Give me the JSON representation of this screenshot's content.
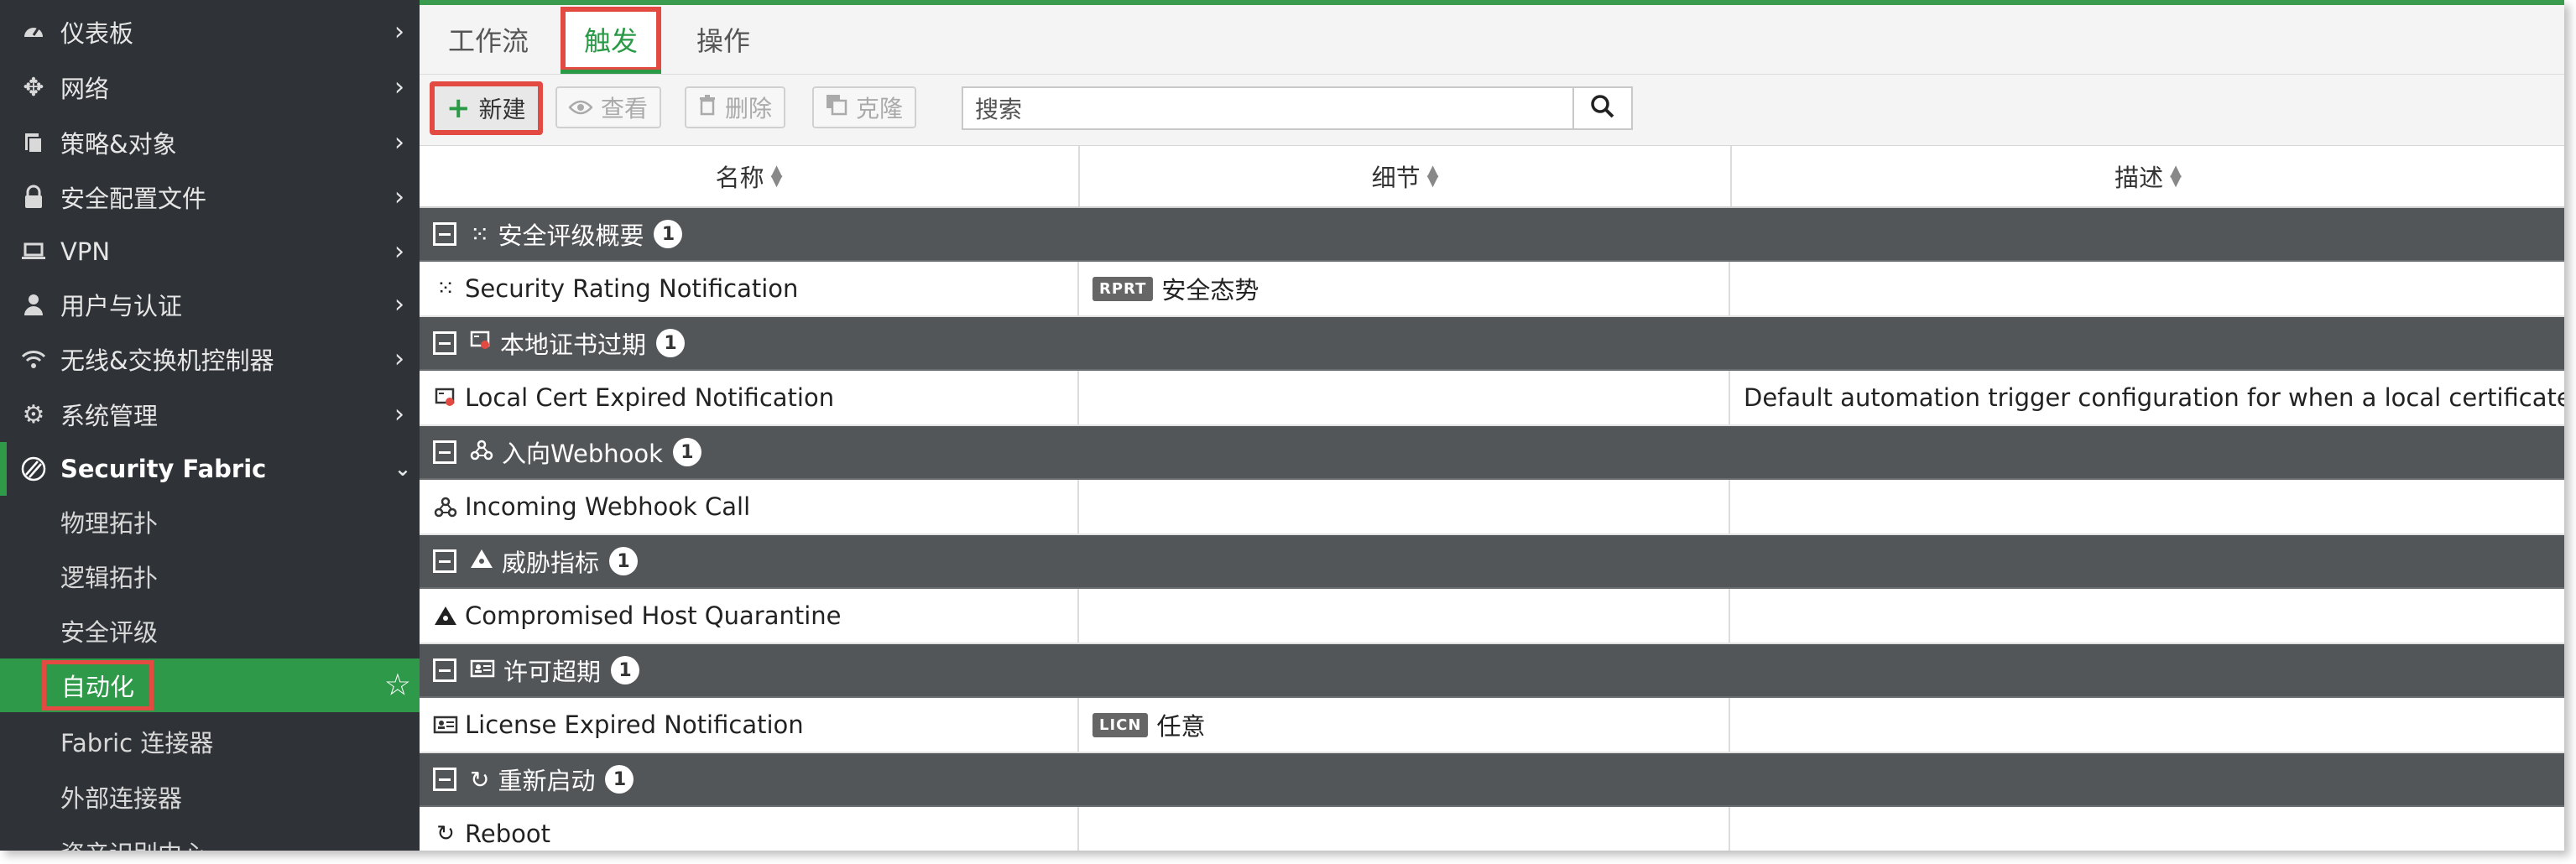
{
  "sidebar": {
    "items": [
      {
        "label": "仪表板",
        "icon": "dashboard-icon"
      },
      {
        "label": "网络",
        "icon": "network-icon"
      },
      {
        "label": "策略&对象",
        "icon": "policy-icon"
      },
      {
        "label": "安全配置文件",
        "icon": "lock-icon"
      },
      {
        "label": "VPN",
        "icon": "laptop-icon"
      },
      {
        "label": "用户与认证",
        "icon": "user-icon"
      },
      {
        "label": "无线&交换机控制器",
        "icon": "wifi-icon"
      },
      {
        "label": "系统管理",
        "icon": "gear-icon"
      }
    ],
    "section": {
      "label": "Security Fabric",
      "icon": "fabric-icon"
    },
    "sub_items": [
      {
        "label": "物理拓扑"
      },
      {
        "label": "逻辑拓扑"
      },
      {
        "label": "安全评级"
      },
      {
        "label": "自动化",
        "active": true
      },
      {
        "label": "Fabric 连接器"
      },
      {
        "label": "外部连接器"
      },
      {
        "label": "资产识别中心"
      }
    ]
  },
  "tabs": [
    {
      "label": "工作流"
    },
    {
      "label": "触发",
      "active": true
    },
    {
      "label": "操作"
    }
  ],
  "toolbar": {
    "new_label": "新建",
    "view_label": "查看",
    "delete_label": "删除",
    "clone_label": "克隆",
    "search_placeholder": "搜索"
  },
  "table": {
    "columns": [
      "名称",
      "细节",
      "描述"
    ],
    "groups": [
      {
        "name": "安全评级概要",
        "count": "1",
        "icon": "security-rating-icon",
        "rows": [
          {
            "name": "Security Rating Notification",
            "tag": "RPRT",
            "detail": "安全态势",
            "description": ""
          }
        ]
      },
      {
        "name": "本地证书过期",
        "count": "1",
        "icon": "certificate-icon",
        "rows": [
          {
            "name": "Local Cert Expired Notification",
            "tag": "",
            "detail": "",
            "description": "Default automation trigger configuration for when a local certificate is near"
          }
        ]
      },
      {
        "name": "入向Webhook",
        "count": "1",
        "icon": "webhook-icon",
        "rows": [
          {
            "name": "Incoming Webhook Call",
            "tag": "",
            "detail": "",
            "description": ""
          }
        ]
      },
      {
        "name": "威胁指标",
        "count": "1",
        "icon": "biohazard-icon",
        "rows": [
          {
            "name": "Compromised Host Quarantine",
            "tag": "",
            "detail": "",
            "description": ""
          }
        ]
      },
      {
        "name": "许可超期",
        "count": "1",
        "icon": "license-card-icon",
        "rows": [
          {
            "name": "License Expired Notification",
            "tag": "LICN",
            "detail": "任意",
            "description": ""
          }
        ]
      },
      {
        "name": "重新启动",
        "count": "1",
        "icon": "reboot-icon",
        "rows": [
          {
            "name": "Reboot",
            "tag": "",
            "detail": "",
            "description": ""
          }
        ]
      }
    ]
  },
  "colors": {
    "accent_green": "#2a9a47",
    "highlight_red": "#e24a42",
    "sidebar_bg": "#2f3337",
    "group_bg": "#535659"
  }
}
